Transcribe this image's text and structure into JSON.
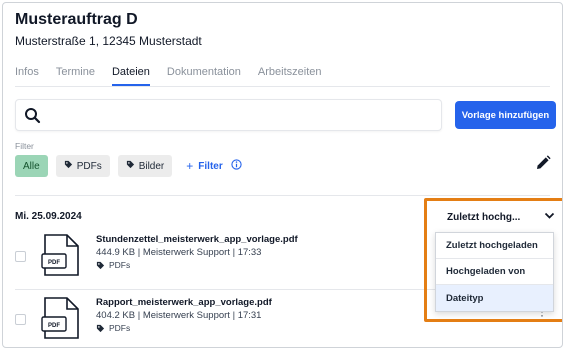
{
  "header": {
    "title": "Musterauftrag D",
    "address": "Musterstraße 1, 12345 Musterstadt"
  },
  "tabs": [
    {
      "label": "Infos",
      "active": false
    },
    {
      "label": "Termine",
      "active": false
    },
    {
      "label": "Dateien",
      "active": true
    },
    {
      "label": "Dokumentation",
      "active": false
    },
    {
      "label": "Arbeitszeiten",
      "active": false
    }
  ],
  "search": {
    "value": "",
    "placeholder": ""
  },
  "actions": {
    "add_template_label": "Vorlage hinzufügen"
  },
  "filter": {
    "label": "Filter",
    "chips": [
      {
        "label": "Alle",
        "active": true
      },
      {
        "label": "PDFs",
        "active": false
      },
      {
        "label": "Bilder",
        "active": false
      }
    ],
    "add_label": "Filter"
  },
  "files_group": {
    "date": "Mi. 25.09.2024"
  },
  "files": [
    {
      "name": "Stundenzettel_meisterwerk_app_vorlage.pdf",
      "meta": "444.9 KB | Meisterwerk Support | 17:33",
      "tag": "PDFs",
      "icon_label": "PDF"
    },
    {
      "name": "Rapport_meisterwerk_app_vorlage.pdf",
      "meta": "404.2 KB | Meisterwerk Support | 17:31",
      "tag": "PDFs",
      "icon_label": "PDF"
    }
  ],
  "sort": {
    "selected": "Zuletzt hochg...",
    "options": [
      "Zuletzt hochgeladen",
      "Hochgeladen von",
      "Dateityp"
    ],
    "highlighted_option": "Dateityp"
  },
  "colors": {
    "accent": "#2563eb",
    "active_chip": "#9bd5b6",
    "highlight_border": "#e47e14"
  }
}
